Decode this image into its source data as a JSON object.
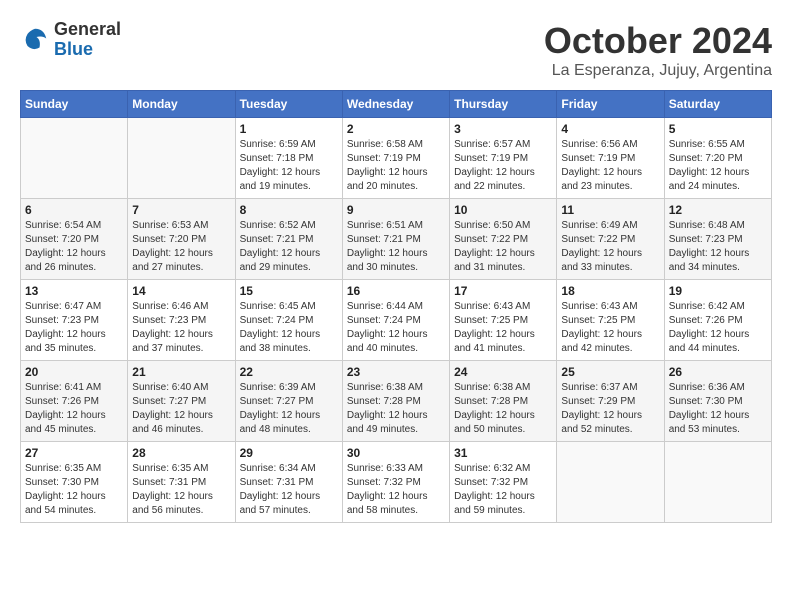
{
  "logo": {
    "general": "General",
    "blue": "Blue"
  },
  "title": "October 2024",
  "location": "La Esperanza, Jujuy, Argentina",
  "days_of_week": [
    "Sunday",
    "Monday",
    "Tuesday",
    "Wednesday",
    "Thursday",
    "Friday",
    "Saturday"
  ],
  "weeks": [
    [
      {
        "day": "",
        "info": ""
      },
      {
        "day": "",
        "info": ""
      },
      {
        "day": "1",
        "info": "Sunrise: 6:59 AM\nSunset: 7:18 PM\nDaylight: 12 hours\nand 19 minutes."
      },
      {
        "day": "2",
        "info": "Sunrise: 6:58 AM\nSunset: 7:19 PM\nDaylight: 12 hours\nand 20 minutes."
      },
      {
        "day": "3",
        "info": "Sunrise: 6:57 AM\nSunset: 7:19 PM\nDaylight: 12 hours\nand 22 minutes."
      },
      {
        "day": "4",
        "info": "Sunrise: 6:56 AM\nSunset: 7:19 PM\nDaylight: 12 hours\nand 23 minutes."
      },
      {
        "day": "5",
        "info": "Sunrise: 6:55 AM\nSunset: 7:20 PM\nDaylight: 12 hours\nand 24 minutes."
      }
    ],
    [
      {
        "day": "6",
        "info": "Sunrise: 6:54 AM\nSunset: 7:20 PM\nDaylight: 12 hours\nand 26 minutes."
      },
      {
        "day": "7",
        "info": "Sunrise: 6:53 AM\nSunset: 7:20 PM\nDaylight: 12 hours\nand 27 minutes."
      },
      {
        "day": "8",
        "info": "Sunrise: 6:52 AM\nSunset: 7:21 PM\nDaylight: 12 hours\nand 29 minutes."
      },
      {
        "day": "9",
        "info": "Sunrise: 6:51 AM\nSunset: 7:21 PM\nDaylight: 12 hours\nand 30 minutes."
      },
      {
        "day": "10",
        "info": "Sunrise: 6:50 AM\nSunset: 7:22 PM\nDaylight: 12 hours\nand 31 minutes."
      },
      {
        "day": "11",
        "info": "Sunrise: 6:49 AM\nSunset: 7:22 PM\nDaylight: 12 hours\nand 33 minutes."
      },
      {
        "day": "12",
        "info": "Sunrise: 6:48 AM\nSunset: 7:23 PM\nDaylight: 12 hours\nand 34 minutes."
      }
    ],
    [
      {
        "day": "13",
        "info": "Sunrise: 6:47 AM\nSunset: 7:23 PM\nDaylight: 12 hours\nand 35 minutes."
      },
      {
        "day": "14",
        "info": "Sunrise: 6:46 AM\nSunset: 7:23 PM\nDaylight: 12 hours\nand 37 minutes."
      },
      {
        "day": "15",
        "info": "Sunrise: 6:45 AM\nSunset: 7:24 PM\nDaylight: 12 hours\nand 38 minutes."
      },
      {
        "day": "16",
        "info": "Sunrise: 6:44 AM\nSunset: 7:24 PM\nDaylight: 12 hours\nand 40 minutes."
      },
      {
        "day": "17",
        "info": "Sunrise: 6:43 AM\nSunset: 7:25 PM\nDaylight: 12 hours\nand 41 minutes."
      },
      {
        "day": "18",
        "info": "Sunrise: 6:43 AM\nSunset: 7:25 PM\nDaylight: 12 hours\nand 42 minutes."
      },
      {
        "day": "19",
        "info": "Sunrise: 6:42 AM\nSunset: 7:26 PM\nDaylight: 12 hours\nand 44 minutes."
      }
    ],
    [
      {
        "day": "20",
        "info": "Sunrise: 6:41 AM\nSunset: 7:26 PM\nDaylight: 12 hours\nand 45 minutes."
      },
      {
        "day": "21",
        "info": "Sunrise: 6:40 AM\nSunset: 7:27 PM\nDaylight: 12 hours\nand 46 minutes."
      },
      {
        "day": "22",
        "info": "Sunrise: 6:39 AM\nSunset: 7:27 PM\nDaylight: 12 hours\nand 48 minutes."
      },
      {
        "day": "23",
        "info": "Sunrise: 6:38 AM\nSunset: 7:28 PM\nDaylight: 12 hours\nand 49 minutes."
      },
      {
        "day": "24",
        "info": "Sunrise: 6:38 AM\nSunset: 7:28 PM\nDaylight: 12 hours\nand 50 minutes."
      },
      {
        "day": "25",
        "info": "Sunrise: 6:37 AM\nSunset: 7:29 PM\nDaylight: 12 hours\nand 52 minutes."
      },
      {
        "day": "26",
        "info": "Sunrise: 6:36 AM\nSunset: 7:30 PM\nDaylight: 12 hours\nand 53 minutes."
      }
    ],
    [
      {
        "day": "27",
        "info": "Sunrise: 6:35 AM\nSunset: 7:30 PM\nDaylight: 12 hours\nand 54 minutes."
      },
      {
        "day": "28",
        "info": "Sunrise: 6:35 AM\nSunset: 7:31 PM\nDaylight: 12 hours\nand 56 minutes."
      },
      {
        "day": "29",
        "info": "Sunrise: 6:34 AM\nSunset: 7:31 PM\nDaylight: 12 hours\nand 57 minutes."
      },
      {
        "day": "30",
        "info": "Sunrise: 6:33 AM\nSunset: 7:32 PM\nDaylight: 12 hours\nand 58 minutes."
      },
      {
        "day": "31",
        "info": "Sunrise: 6:32 AM\nSunset: 7:32 PM\nDaylight: 12 hours\nand 59 minutes."
      },
      {
        "day": "",
        "info": ""
      },
      {
        "day": "",
        "info": ""
      }
    ]
  ]
}
